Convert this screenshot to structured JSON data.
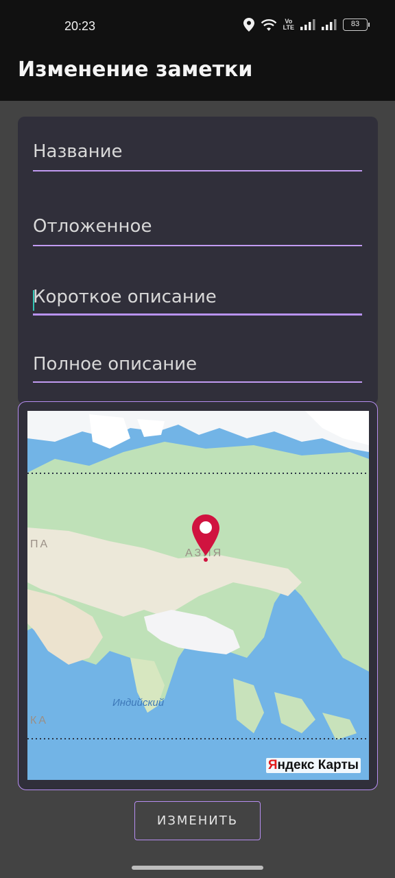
{
  "status_bar": {
    "time": "20:23",
    "volte": "Vo\nLTE",
    "battery": "83",
    "icons": [
      "location-icon",
      "wifi-icon",
      "volte-icon",
      "signal-icon",
      "signal-icon",
      "battery-icon"
    ]
  },
  "app_bar": {
    "title": "Изменение заметки"
  },
  "form": {
    "title_placeholder": "Название",
    "delayed_placeholder": "Отложенное",
    "short_description_placeholder": "Короткое описание",
    "full_description_placeholder": "Полное описание"
  },
  "map": {
    "region_label": "АЗИЯ",
    "left_label_top": "ПА",
    "left_label_bottom": "КА",
    "ocean_label": "Индийский",
    "logo_prefix": "Я",
    "logo_rest": "ндекс Карты",
    "pin_color": "#d0133f"
  },
  "actions": {
    "submit_label": "ИЗМЕНИТЬ"
  },
  "colors": {
    "accent": "#b78ef2",
    "card": "#302f3a",
    "background": "#434343",
    "cursor": "#31c6b5"
  }
}
